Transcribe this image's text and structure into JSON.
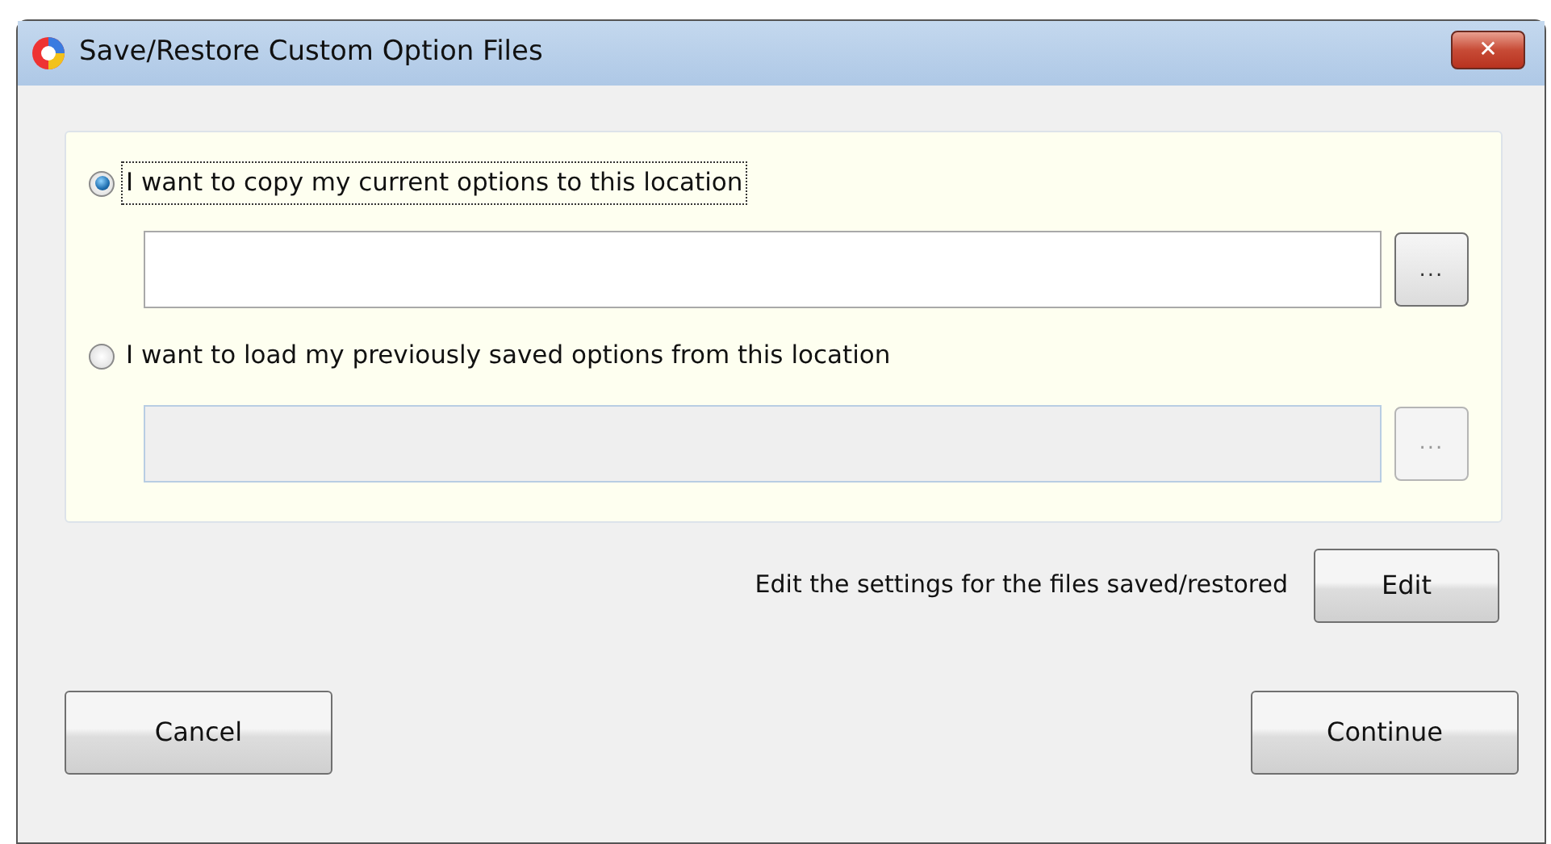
{
  "window": {
    "title": "Save/Restore Custom Option Files",
    "close": "✕"
  },
  "options": [
    {
      "label": "I want to copy my current options to this location",
      "selected": true,
      "field_disabled": false,
      "browse": "..."
    },
    {
      "label": "I want to load my previously saved options from this location",
      "selected": false,
      "field_disabled": true,
      "browse": "..."
    }
  ],
  "edit_row": {
    "text": "Edit the settings for the files saved/restored",
    "button": "Edit"
  },
  "buttons": [
    "Cancel",
    "Continue"
  ]
}
